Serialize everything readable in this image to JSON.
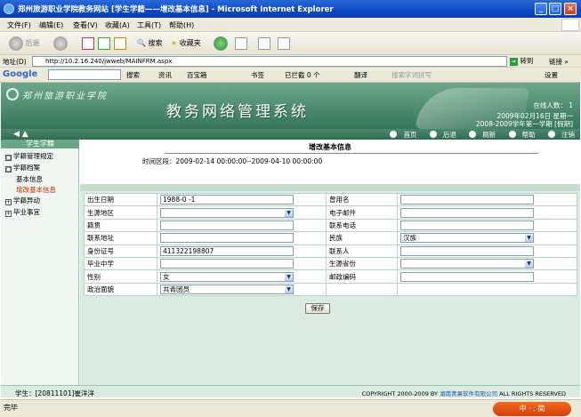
{
  "window": {
    "title": "郑州旅游职业学院教务网站 [学生学籍——增改基本信息] - Microsoft Internet Explorer",
    "minimize": "_",
    "maximize": "□",
    "close": "×"
  },
  "menu": [
    "文件(F)",
    "编辑(E)",
    "查看(V)",
    "收藏(A)",
    "工具(T)",
    "帮助(H)"
  ],
  "toolbar": {
    "back": "后退",
    "search": "搜索",
    "favorites": "收藏夹"
  },
  "address": {
    "label": "地址(D)",
    "url": "http://10.2.16.240/jwweb/MAINFRM.aspx",
    "go": "转到",
    "links": "链接 »"
  },
  "google": {
    "logo": "Google",
    "search": "搜索",
    "news": "资讯",
    "bookmarks_tool": "百宝箱",
    "bookmarks": "书签",
    "blocked": "已拦截 0 个",
    "translate": "翻译",
    "suggest": "搜索字词拼写",
    "settings": "设置"
  },
  "banner": {
    "school": "郑州旅游职业学院",
    "system_title": "教务网络管理系统",
    "online": "在线人数： 1",
    "date": "2009年02月16日 星期一",
    "term": "2008-2009学年第一学期 [假期]"
  },
  "nav": {
    "home": "首页",
    "back": "后退",
    "refresh": "刷新",
    "help": "帮助",
    "logout": "注销",
    "arrows": "◀  ▲"
  },
  "sidebar": {
    "heading": "学生学籍",
    "items": [
      {
        "label": "学籍管理规定",
        "box": "□"
      },
      {
        "label": "学籍档案",
        "box": "□"
      },
      {
        "label": "基本信息"
      },
      {
        "label": "增改基本信息"
      },
      {
        "label": "学籍异动",
        "box": "+"
      },
      {
        "label": "毕业事宜",
        "box": "+"
      }
    ]
  },
  "page": {
    "title": "增改基本信息",
    "time_range": "时间区段：2009-02-14 00:00:00--2009-04-10 00:00:00"
  },
  "form": {
    "rows": [
      {
        "l1": "出生日期",
        "v1": "1988-0 -1",
        "t1": "input",
        "l2": "曾用名",
        "v2": "",
        "t2": "input"
      },
      {
        "l1": "生源地区",
        "v1": "",
        "t1": "select",
        "l2": "电子邮件",
        "v2": "",
        "t2": "input"
      },
      {
        "l1": "籍贯",
        "v1": "",
        "t1": "input",
        "l2": "联系电话",
        "v2": "",
        "t2": "input"
      },
      {
        "l1": "联系地址",
        "v1": "",
        "t1": "input",
        "l2": "民族",
        "v2": "汉族",
        "t2": "select"
      },
      {
        "l1": "身份证号",
        "v1": "411322198807",
        "t1": "input",
        "l2": "联系人",
        "v2": "",
        "t2": "input"
      },
      {
        "l1": "毕业中学",
        "v1": "",
        "t1": "input",
        "l2": "生源省份",
        "v2": "",
        "t2": "select"
      },
      {
        "l1": "性别",
        "v1": "女",
        "t1": "select",
        "l2": "邮政编码",
        "v2": "",
        "t2": "input"
      },
      {
        "l1": "政治面貌",
        "v1": "共青团员",
        "t1": "select",
        "l2": "",
        "v2": "",
        "t2": "none"
      }
    ],
    "save": "保存"
  },
  "footer": {
    "student": "学生：[20811101]崔洋洋",
    "copyright": "COPYRIGHT 2000-2009 BY",
    "company": "湖南青果软件有限公司",
    "rights": "ALL RIGHTS RESERVED"
  },
  "status": {
    "text": "完毕",
    "zone": "中 · : 简"
  },
  "colors": {
    "banner": "#3f7f62",
    "form_bg": "#dcebe2",
    "active_item": "#cc2200"
  }
}
